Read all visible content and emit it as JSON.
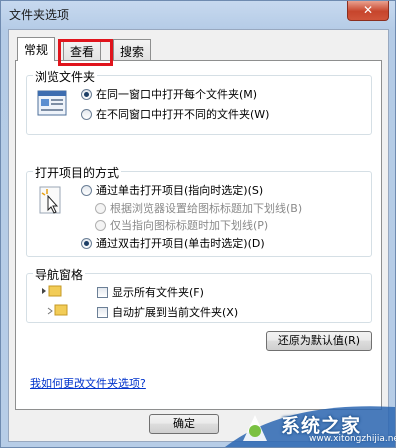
{
  "window": {
    "title": "文件夹选项",
    "close_glyph": "✕"
  },
  "tabs": [
    {
      "label": "常规",
      "active": true
    },
    {
      "label": "查看",
      "active": false,
      "highlighted": true
    },
    {
      "label": "搜索",
      "active": false
    }
  ],
  "browse": {
    "title": "浏览文件夹",
    "options": [
      {
        "label": "在同一窗口中打开每个文件夹(M)",
        "checked": true
      },
      {
        "label": "在不同窗口中打开不同的文件夹(W)",
        "checked": false
      }
    ]
  },
  "click": {
    "title": "打开项目的方式",
    "single": "通过单击打开项目(指向时选定)(S)",
    "sub1": "根据浏览器设置给图标标题加下划线(B)",
    "sub2": "仅当指向图标标题时加下划线(P)",
    "double": "通过双击打开项目(单击时选定)(D)"
  },
  "nav": {
    "title": "导航窗格",
    "show_all": "显示所有文件夹(F)",
    "auto_expand": "自动扩展到当前文件夹(X)"
  },
  "restore_label": "还原为默认值(R)",
  "help_link": "我如何更改文件夹选项?",
  "ok_label": "确定",
  "watermark": {
    "text": "系统之家",
    "url": "www.xitongzhijia.net"
  },
  "colors": {
    "highlight": "#e0141c",
    "link": "#0033cc",
    "close": "#c7452c"
  }
}
